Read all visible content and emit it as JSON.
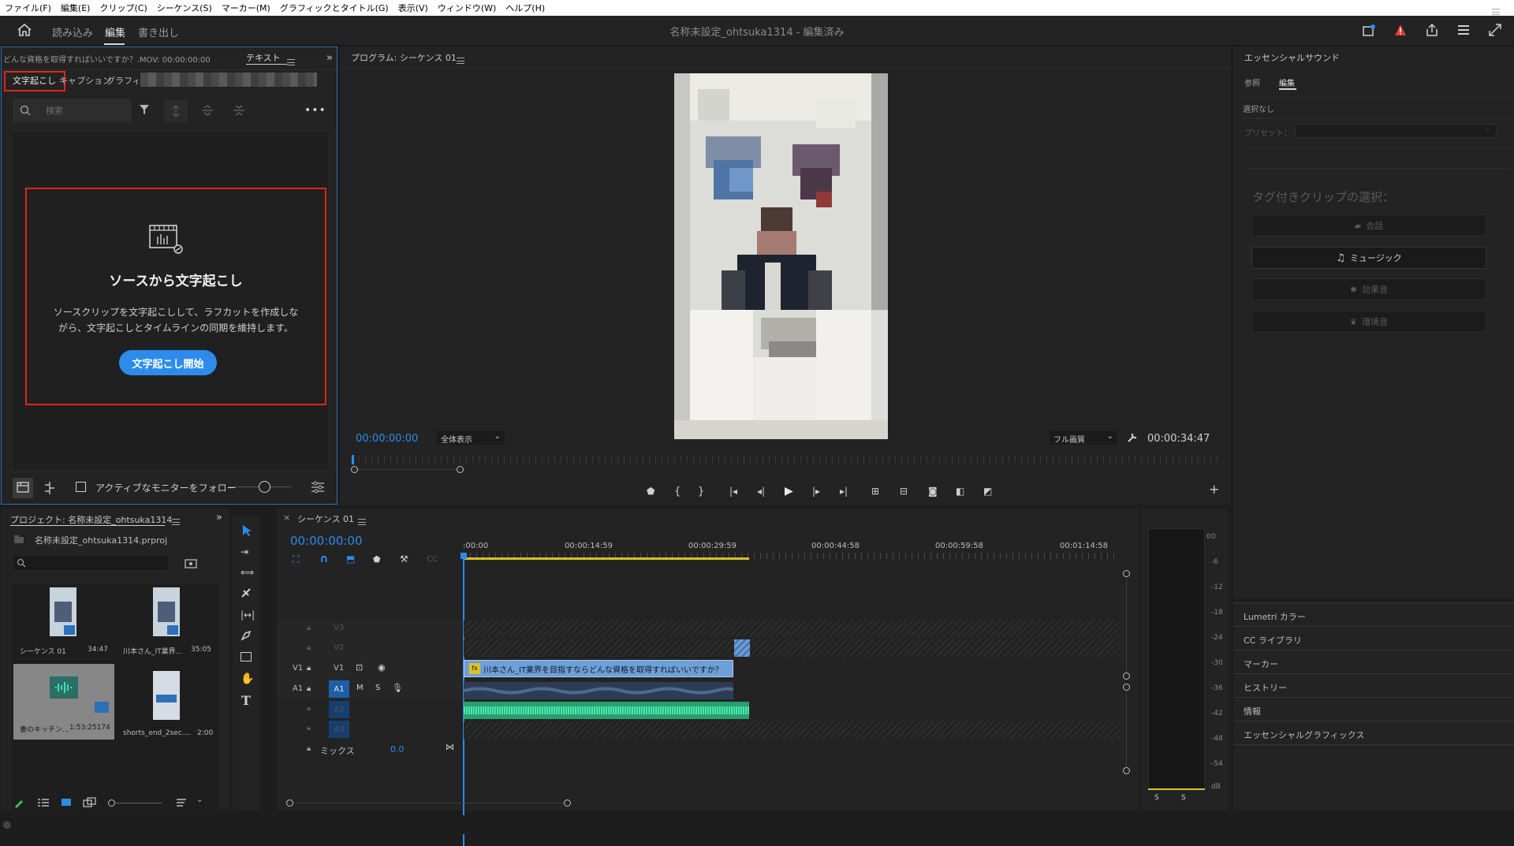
{
  "menubar": [
    "ファイル(F)",
    "編集(E)",
    "クリップ(C)",
    "シーケンス(S)",
    "マーカー(M)",
    "グラフィックとタイトル(G)",
    "表示(V)",
    "ウィンドウ(W)",
    "ヘルプ(H)"
  ],
  "topbar": {
    "workspaces": [
      "読み込み",
      "編集",
      "書き出し"
    ],
    "active": "編集",
    "doc_title": "名称未設定_ohtsuka1314",
    "doc_status": " - 編集済み"
  },
  "text_panel": {
    "source_line": "どんな資格を取得すればいいですか？.MOV: 00:00:00:00",
    "panel_tab": "テキスト",
    "tabs": [
      "文字起こし",
      "キャプション",
      "グラフィック"
    ],
    "search_placeholder": "検索",
    "empty_title": "ソースから文字起こし",
    "empty_desc": "ソースクリップを文字起こしして、ラフカットを作成しながら、文字起こしとタイムラインの同期を維持します。",
    "start_button": "文字起こし開始",
    "follow_monitor": "アクティブなモニターをフォロー"
  },
  "program": {
    "title": "プログラム: シーケンス 01",
    "timecode": "00:00:00:00",
    "zoom": "全体表示",
    "quality": "フル画質",
    "duration": "00:00:34:47"
  },
  "project": {
    "title": "プロジェクト: 名称未設定_ohtsuka1314",
    "file": "名称未設定_ohtsuka1314.prproj",
    "items": [
      {
        "name": "シーケンス 01",
        "dur": "34:47"
      },
      {
        "name": "川本さん_IT業界...",
        "dur": "35:05"
      },
      {
        "name": "妻のキッチン...",
        "dur": "1:53:25174"
      },
      {
        "name": "shorts_end_2sec....",
        "dur": "2:00"
      }
    ]
  },
  "timeline": {
    "tab": "シーケンス 01",
    "timecode": "00:00:00:00",
    "ruler": [
      ":00:00",
      "00:00:14:59",
      "00:00:29:59",
      "00:00:44:58",
      "00:00:59:58",
      "00:01:14:58"
    ],
    "tracks": [
      "V3",
      "V2",
      "V1",
      "A1",
      "A2",
      "A3"
    ],
    "mix_label": "ミックス",
    "mix_value": "0.0",
    "clip_title": "川本さん_IT業界を目指すならどんな資格を取得すればいいですか？",
    "m": "M",
    "s": "S"
  },
  "meter": {
    "scale": [
      "0",
      "-6",
      "-12",
      "-18",
      "-24",
      "-30",
      "-36",
      "-42",
      "-48",
      "-54",
      "dB"
    ],
    "solo": [
      "S",
      "S"
    ]
  },
  "essential_sound": {
    "title": "エッセンシャルサウンド",
    "tabs": [
      "参照",
      "編集"
    ],
    "active_tab": "編集",
    "none_selected": "選択なし",
    "preset_label": "プリセット：",
    "tag_title": "タグ付きクリップの選択：",
    "buttons": [
      "会話",
      "ミュージック",
      "効果音",
      "環境音"
    ]
  },
  "sidebar": [
    "Lumetri カラー",
    "CC ライブラリ",
    "マーカー",
    "ヒストリー",
    "情報",
    "エッセンシャルグラフィックス"
  ],
  "colors": {
    "accent": "#2d8ceb",
    "timecode": "#2d8ceb",
    "clip_video": "#6f9fd8",
    "clip_audio": "#3fbf8a",
    "warning": "#e03c31"
  }
}
